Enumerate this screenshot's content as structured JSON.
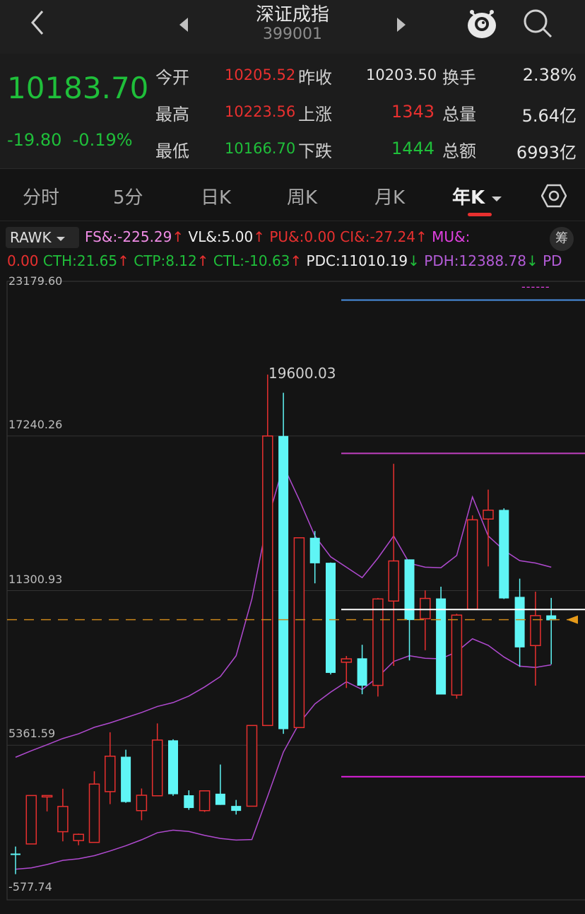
{
  "header": {
    "title": "深证成指",
    "code": "399001"
  },
  "quote": {
    "price": "10183.70",
    "change": "-19.80",
    "change_pct": "-0.19%",
    "open_label": "今开",
    "open": "10205.52",
    "prev_close_label": "昨收",
    "prev_close": "10203.50",
    "turnover_label": "换手",
    "turnover": "2.38%",
    "high_label": "最高",
    "high": "10223.56",
    "up_label": "上涨",
    "up": "1343",
    "volume_label": "总量",
    "volume": "5.64亿",
    "low_label": "最低",
    "low": "10166.70",
    "down_label": "下跌",
    "down": "1444",
    "amount_label": "总额",
    "amount": "6993亿"
  },
  "tabs": [
    "分时",
    "5分",
    "日K",
    "周K",
    "月K",
    "年K"
  ],
  "indicators": {
    "selector": "RAWK",
    "fs": "FS&:-225.29",
    "vl": "VL&:5.00",
    "pu": "PU&:0.00",
    "ci": "CI&:-27.24",
    "mu": "MU&:",
    "mu_val": "0.00",
    "cth": "CTH:21.65",
    "ctp": "CTP:8.12",
    "ctl": "CTL:-10.63",
    "pdc": "PDC:11010.19",
    "pdh": "PDH:12388.78",
    "pdl": "PD",
    "chips_label": "筹"
  },
  "chart_data": {
    "type": "candlestick",
    "y_axis_labels": [
      "23179.60",
      "17240.26",
      "11300.93",
      "5361.59",
      "-577.74"
    ],
    "ylim": [
      -577.74,
      23179.6
    ],
    "annotation": "19600.03",
    "reference_line": 10183.7,
    "horizontal_levels": [
      22460,
      16570,
      10575,
      4155
    ],
    "candles": [
      {
        "o": 1200,
        "h": 1470,
        "l": 410,
        "c": 1180
      },
      {
        "o": 1570,
        "h": 3010,
        "l": 1570,
        "c": 3430
      },
      {
        "o": 3430,
        "h": 3430,
        "l": 2820,
        "c": 3430
      },
      {
        "o": 2040,
        "h": 3690,
        "l": 1670,
        "c": 3010
      },
      {
        "o": 1700,
        "h": 1970,
        "l": 1520,
        "c": 1940
      },
      {
        "o": 1630,
        "h": 4360,
        "l": 1630,
        "c": 3870
      },
      {
        "o": 3580,
        "h": 5860,
        "l": 3100,
        "c": 4940
      },
      {
        "o": 4920,
        "h": 5190,
        "l": 3150,
        "c": 3180
      },
      {
        "o": 2850,
        "h": 3700,
        "l": 2480,
        "c": 3440
      },
      {
        "o": 3420,
        "h": 6200,
        "l": 3420,
        "c": 5560
      },
      {
        "o": 5550,
        "h": 5590,
        "l": 3420,
        "c": 3480
      },
      {
        "o": 3440,
        "h": 3630,
        "l": 2880,
        "c": 2950
      },
      {
        "o": 2850,
        "h": 3490,
        "l": 2800,
        "c": 3610
      },
      {
        "o": 3500,
        "h": 4620,
        "l": 3070,
        "c": 3070
      },
      {
        "o": 3030,
        "h": 3260,
        "l": 2700,
        "c": 2840
      },
      {
        "o": 3020,
        "h": 6100,
        "l": 3020,
        "c": 6120
      },
      {
        "o": 6120,
        "h": 19600,
        "l": 6120,
        "c": 17240
      },
      {
        "o": 17240,
        "h": 18900,
        "l": 5800,
        "c": 5980
      },
      {
        "o": 6040,
        "h": 13330,
        "l": 6040,
        "c": 13330
      },
      {
        "o": 13330,
        "h": 13590,
        "l": 11580,
        "c": 12350
      },
      {
        "o": 12370,
        "h": 12380,
        "l": 8080,
        "c": 8140
      },
      {
        "o": 8550,
        "h": 8790,
        "l": 7560,
        "c": 8680
      },
      {
        "o": 8700,
        "h": 9220,
        "l": 7320,
        "c": 7650
      },
      {
        "o": 7660,
        "h": 11020,
        "l": 7230,
        "c": 10980
      },
      {
        "o": 10900,
        "h": 16170,
        "l": 8410,
        "c": 12440
      },
      {
        "o": 12500,
        "h": 12500,
        "l": 8620,
        "c": 10170
      },
      {
        "o": 10220,
        "h": 11310,
        "l": 9010,
        "c": 11000
      },
      {
        "o": 11000,
        "h": 11450,
        "l": 8450,
        "c": 7310
      },
      {
        "o": 7290,
        "h": 10410,
        "l": 7150,
        "c": 10360
      },
      {
        "o": 10590,
        "h": 14190,
        "l": 10580,
        "c": 14020
      },
      {
        "o": 14050,
        "h": 15180,
        "l": 12230,
        "c": 14390
      },
      {
        "o": 14400,
        "h": 14460,
        "l": 10980,
        "c": 11000
      },
      {
        "o": 11060,
        "h": 11760,
        "l": 8370,
        "c": 9120
      },
      {
        "o": 9190,
        "h": 11260,
        "l": 7650,
        "c": 10340
      },
      {
        "o": 10350,
        "h": 11020,
        "l": 8470,
        "c": 10160
      }
    ],
    "upper_band": [
      4900,
      5150,
      5380,
      5620,
      5800,
      6050,
      6220,
      6420,
      6620,
      6850,
      7000,
      7250,
      7600,
      8000,
      8800,
      10980,
      14000,
      16100,
      14800,
      13400,
      12600,
      12200,
      11800,
      12550,
      13400,
      12350,
      12200,
      12180,
      12650,
      14900,
      13400,
      12850,
      12450,
      12360,
      12200
    ],
    "lower_band": [
      600,
      650,
      780,
      940,
      1000,
      1120,
      1300,
      1500,
      1730,
      2000,
      2100,
      2050,
      1900,
      1780,
      1720,
      1740,
      3400,
      5100,
      6200,
      6950,
      7400,
      7800,
      7500,
      7980,
      8580,
      8800,
      8700,
      8680,
      8950,
      9450,
      9200,
      8750,
      8400,
      8350,
      8450
    ],
    "dashes_label": "------"
  }
}
